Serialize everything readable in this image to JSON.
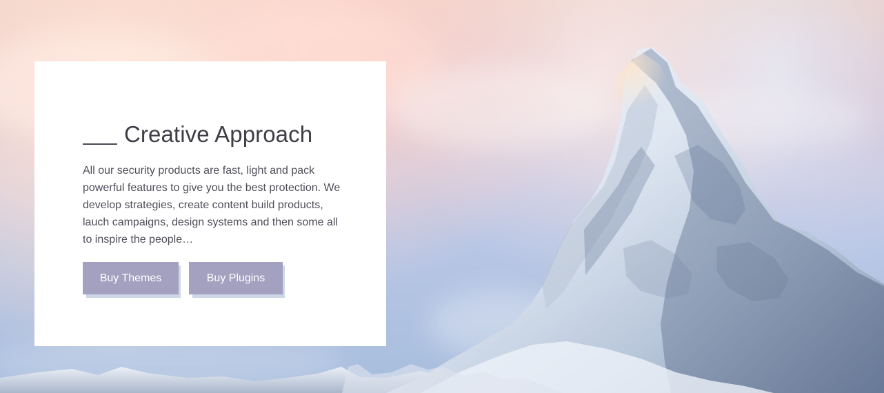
{
  "hero": {
    "title": "Creative Approach",
    "description": "All our security products are fast, light and pack powerful features to give you the best protection. We develop strategies, create content build products, lauch campaigns, design systems and then some all to inspire the people…",
    "buttons": [
      {
        "label": "Buy Themes"
      },
      {
        "label": "Buy Plugins"
      }
    ]
  },
  "colors": {
    "card_background": "#ffffff",
    "title_text": "#3f3d46",
    "body_text": "#4f4c58",
    "button_fill": "#a3a1bf",
    "button_shadow": "#cdd7e8"
  }
}
